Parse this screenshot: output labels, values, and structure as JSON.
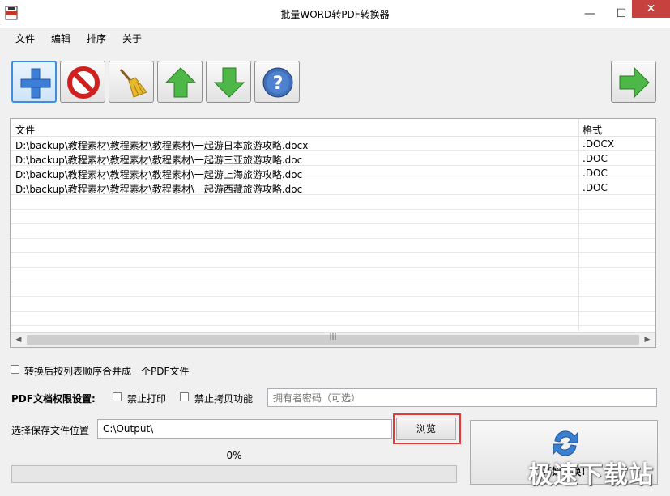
{
  "window": {
    "title": "批量WORD转PDF转换器",
    "minimize": "—",
    "maximize": "☐",
    "close": "✕"
  },
  "menu": [
    "文件",
    "编辑",
    "排序",
    "关于"
  ],
  "toolbar": [
    {
      "name": "add-icon"
    },
    {
      "name": "delete-icon"
    },
    {
      "name": "clear-broom-icon"
    },
    {
      "name": "move-up-icon"
    },
    {
      "name": "move-down-icon"
    },
    {
      "name": "help-icon"
    },
    {
      "name": "convert-arrow-icon"
    }
  ],
  "grid": {
    "headers": {
      "file": "文件",
      "format": "格式"
    },
    "rows": [
      {
        "file": "D:\\backup\\教程素材\\教程素材\\教程素材\\一起游日本旅游攻略.docx",
        "format": ".DOCX"
      },
      {
        "file": "D:\\backup\\教程素材\\教程素材\\教程素材\\一起游三亚旅游攻略.doc",
        "format": ".DOC"
      },
      {
        "file": "D:\\backup\\教程素材\\教程素材\\教程素材\\一起游上海旅游攻略.doc",
        "format": ".DOC"
      },
      {
        "file": "D:\\backup\\教程素材\\教程素材\\教程素材\\一起游西藏旅游攻略.doc",
        "format": ".DOC"
      }
    ],
    "scroll_grip": "|||"
  },
  "merge_option": {
    "label": "转换后按列表顺序合并成一个PDF文件",
    "checked": false
  },
  "permissions": {
    "label": "PDF文档权限设置:",
    "no_print": {
      "label": "禁止打印",
      "checked": false
    },
    "no_copy": {
      "label": "禁止拷贝功能",
      "checked": false
    },
    "owner_password_placeholder": "拥有者密码（可选）"
  },
  "output": {
    "label": "选择保存文件位置",
    "path": "C:\\Output\\",
    "browse_label": "浏览"
  },
  "progress": {
    "text": "0%",
    "value": 0
  },
  "start_button": {
    "label": "开始转换!"
  },
  "watermark": "极速下载站",
  "colors": {
    "close": "#c7413e",
    "highlight": "#e03a3a",
    "selected_border": "#3d8ee0"
  }
}
